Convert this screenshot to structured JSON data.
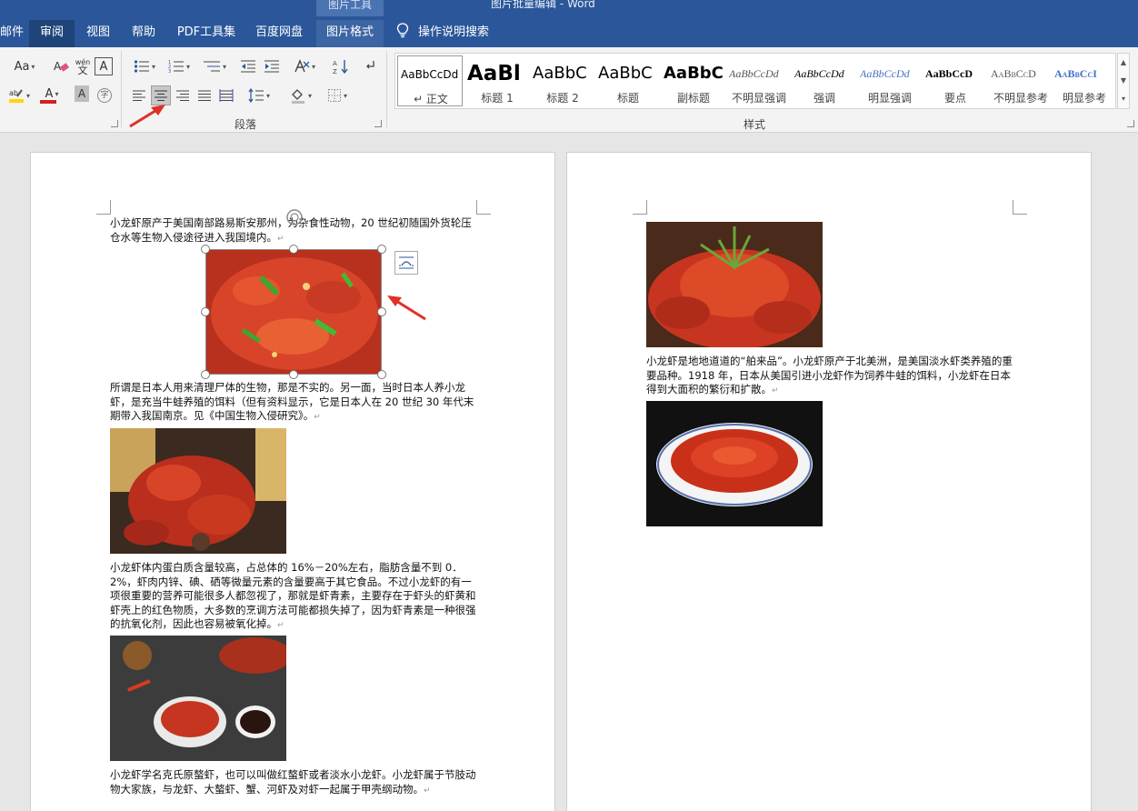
{
  "window": {
    "context_tab_header": "图片工具",
    "title": "图片批量编辑 - Word"
  },
  "tabs": [
    {
      "label": "邮件"
    },
    {
      "label": "审阅"
    },
    {
      "label": "视图"
    },
    {
      "label": "帮助"
    },
    {
      "label": "PDF工具集"
    },
    {
      "label": "百度网盘"
    },
    {
      "label": "图片格式"
    }
  ],
  "tell_me": {
    "label": "操作说明搜索",
    "icon": "lightbulb-icon"
  },
  "ribbon": {
    "font_group": {
      "change_case_label": "Aa",
      "phonetic_top": "wén",
      "phonetic_bottom": "文",
      "char_border_label": "A",
      "font_color_label": "A",
      "char_shading_label": "A",
      "enclose_label": "字"
    },
    "paragraph_group": {
      "label": "段落",
      "active_alignment": "center"
    },
    "styles_group": {
      "label": "样式",
      "styles": [
        {
          "sample": "AaBbCcDd",
          "name": "↵ 正文"
        },
        {
          "sample": "AaBl",
          "name": "标题 1"
        },
        {
          "sample": "AaBbC",
          "name": "标题 2"
        },
        {
          "sample": "AaBbC",
          "name": "标题"
        },
        {
          "sample": "AaBbC",
          "name": "副标题"
        },
        {
          "sample": "AaBbCcDd",
          "name": "不明显强调"
        },
        {
          "sample": "AaBbCcDd",
          "name": "强调"
        },
        {
          "sample": "AaBbCcDd",
          "name": "明显强调"
        },
        {
          "sample": "AaBbCcD",
          "name": "要点"
        },
        {
          "sample": "AaBbCcD",
          "name": "不明显参考"
        },
        {
          "sample": "AaBbCcI",
          "name": "明显参考"
        }
      ]
    }
  },
  "document": {
    "page1": {
      "p1": "小龙虾原产于美国南部路易斯安那州，为杂食性动物，20 世纪初随国外货轮压仓水等生物入侵途径进入我国境内。",
      "p2": "所谓是日本人用来清理尸体的生物，那是不实的。另一面，当时日本人养小龙虾，是充当牛蛙养殖的饵料（但有资料显示，它是日本人在 20 世纪 30 年代末期带入我国南京。见《中国生物入侵研究》。",
      "p3": "小龙虾体内蛋白质含量较高，占总体的 16%－20%左右，脂肪含量不到 0．2%，虾肉内锌、碘、硒等微量元素的含量要高于其它食品。不过小龙虾的有一项很重要的营养可能很多人都忽视了，那就是虾青素，主要存在于虾头的虾黄和虾壳上的红色物质，大多数的烹调方法可能都损失掉了，因为虾青素是一种很强的抗氧化剂，因此也容易被氧化掉。",
      "p4": "小龙虾学名克氏原螯虾，也可以叫做红螯虾或者淡水小龙虾。小龙虾属于节肢动物大家族，与龙虾、大螯虾、蟹、河虾及对虾一起属于甲壳纲动物。"
    },
    "page2": {
      "p1": "小龙虾是地地道道的“舶来品”。小龙虾原产于北美洲，是美国淡水虾类养殖的重要品种。1918 年，日本从美国引进小龙虾作为饲养牛蛙的饵料，小龙虾在日本得到大面积的繁衍和扩散。"
    }
  },
  "colors": {
    "title_bar": "#2b579a",
    "ribbon_bg": "#f3f3f3",
    "annotation_arrow": "#e0302a",
    "highlight_yellow": "#ffd700",
    "font_red": "#d42020"
  }
}
